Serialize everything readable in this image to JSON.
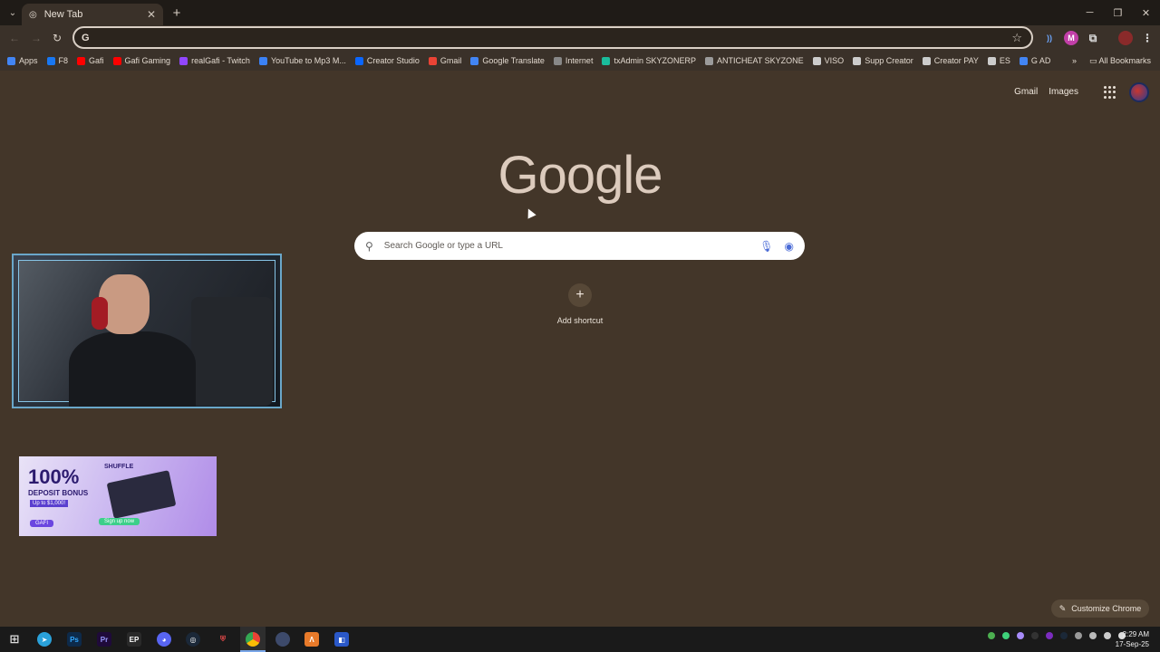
{
  "tab": {
    "title": "New Tab"
  },
  "omnibox": {
    "value": "",
    "placeholder": ""
  },
  "bookmarks": [
    {
      "label": "Apps",
      "color": "#4285f4"
    },
    {
      "label": "F8",
      "color": "#1877f2"
    },
    {
      "label": "Gafi",
      "color": "#ff0000"
    },
    {
      "label": "Gafi Gaming",
      "color": "#ff0000"
    },
    {
      "label": "realGafi - Twitch",
      "color": "#9146ff"
    },
    {
      "label": "YouTube to Mp3 M...",
      "color": "#3b82f6"
    },
    {
      "label": "Creator Studio",
      "color": "#0a66ff"
    },
    {
      "label": "Gmail",
      "color": "#ea4335"
    },
    {
      "label": "Google Translate",
      "color": "#4285f4"
    },
    {
      "label": "Internet",
      "color": "#888888"
    },
    {
      "label": "txAdmin SKYZONERP",
      "color": "#1abc9c"
    },
    {
      "label": "ANTICHEAT SKYZONE",
      "color": "#9b9b9b"
    },
    {
      "label": "VISO",
      "color": "#cccccc"
    },
    {
      "label": "Supp Creator",
      "color": "#cccccc"
    },
    {
      "label": "Creator PAY",
      "color": "#cccccc"
    },
    {
      "label": "ES",
      "color": "#cccccc"
    },
    {
      "label": "G AD",
      "color": "#4285f4"
    }
  ],
  "all_bookmarks": "All Bookmarks",
  "top_links": {
    "gmail": "Gmail",
    "images": "Images"
  },
  "logo": "Google",
  "search": {
    "placeholder": "Search Google or type a URL"
  },
  "shortcut": {
    "icon": "+",
    "label": "Add shortcut"
  },
  "ad": {
    "big": "100%",
    "deposit": "DEPOSIT BONUS",
    "upto": "Up to $1,000!",
    "code": "GAFI",
    "brand": "SHUFFLE",
    "signup": "Sign up now"
  },
  "customize": "Customize Chrome",
  "clock": {
    "time": "2:29 AM",
    "date": "17-Sep-25"
  },
  "taskbar": [
    "windows",
    "telegram",
    "photoshop",
    "premiere",
    "epic",
    "discord",
    "steam",
    "shield",
    "chrome",
    "app",
    "app2",
    "app3"
  ]
}
